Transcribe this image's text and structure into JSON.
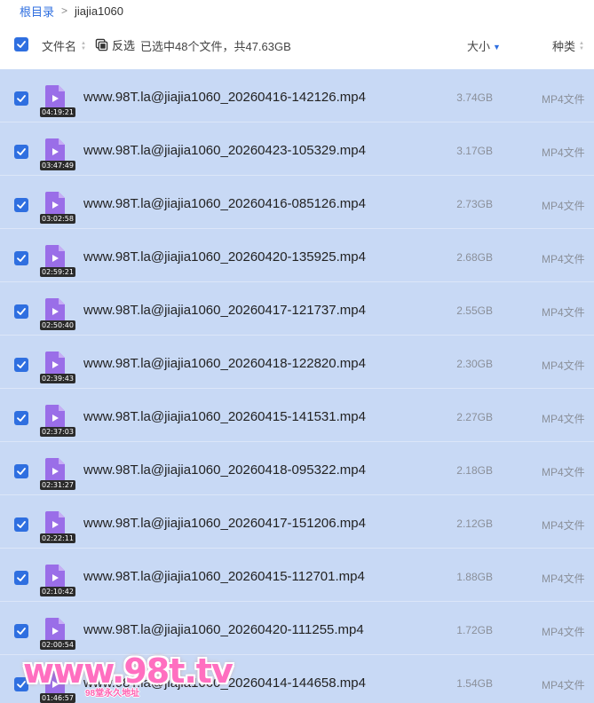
{
  "breadcrumb": {
    "root_label": "根目录",
    "separator": ">",
    "current": "jiajia1060"
  },
  "header": {
    "select_all_checked": true,
    "name_column": "文件名",
    "invert_label": "反选",
    "selection_summary": "已选中48个文件，共47.63GB",
    "size_column": "大小",
    "type_column": "种类"
  },
  "colors": {
    "accent": "#2f6fe0",
    "row_selected_bg": "#c8d9f5",
    "file_icon": "#9a6ee8"
  },
  "files": [
    {
      "name": "www.98T.la@jiajia1060_20260416-142126.mp4",
      "duration": "04:19:21",
      "size": "3.74GB",
      "type": "MP4文件",
      "checked": true,
      "icon": "video-file-icon"
    },
    {
      "name": "www.98T.la@jiajia1060_20260423-105329.mp4",
      "duration": "03:47:49",
      "size": "3.17GB",
      "type": "MP4文件",
      "checked": true,
      "icon": "video-file-icon"
    },
    {
      "name": "www.98T.la@jiajia1060_20260416-085126.mp4",
      "duration": "03:02:58",
      "size": "2.73GB",
      "type": "MP4文件",
      "checked": true,
      "icon": "video-file-icon"
    },
    {
      "name": "www.98T.la@jiajia1060_20260420-135925.mp4",
      "duration": "02:59:21",
      "size": "2.68GB",
      "type": "MP4文件",
      "checked": true,
      "icon": "video-file-icon"
    },
    {
      "name": "www.98T.la@jiajia1060_20260417-121737.mp4",
      "duration": "02:50:40",
      "size": "2.55GB",
      "type": "MP4文件",
      "checked": true,
      "icon": "video-file-icon"
    },
    {
      "name": "www.98T.la@jiajia1060_20260418-122820.mp4",
      "duration": "02:39:43",
      "size": "2.30GB",
      "type": "MP4文件",
      "checked": true,
      "icon": "video-file-icon"
    },
    {
      "name": "www.98T.la@jiajia1060_20260415-141531.mp4",
      "duration": "02:37:03",
      "size": "2.27GB",
      "type": "MP4文件",
      "checked": true,
      "icon": "video-file-icon"
    },
    {
      "name": "www.98T.la@jiajia1060_20260418-095322.mp4",
      "duration": "02:31:27",
      "size": "2.18GB",
      "type": "MP4文件",
      "checked": true,
      "icon": "video-file-icon"
    },
    {
      "name": "www.98T.la@jiajia1060_20260417-151206.mp4",
      "duration": "02:22:11",
      "size": "2.12GB",
      "type": "MP4文件",
      "checked": true,
      "icon": "video-file-icon"
    },
    {
      "name": "www.98T.la@jiajia1060_20260415-112701.mp4",
      "duration": "02:10:42",
      "size": "1.88GB",
      "type": "MP4文件",
      "checked": true,
      "icon": "video-file-icon"
    },
    {
      "name": "www.98T.la@jiajia1060_20260420-111255.mp4",
      "duration": "02:00:54",
      "size": "1.72GB",
      "type": "MP4文件",
      "checked": true,
      "icon": "video-file-icon"
    },
    {
      "name": "www.98T.la@jiajia1060_20260414-144658.mp4",
      "duration": "01:46:57",
      "size": "1.54GB",
      "type": "MP4文件",
      "checked": true,
      "icon": "video-file-icon"
    }
  ],
  "watermark": {
    "main": "www.98t.tv",
    "sub": "98堂永久地址"
  }
}
